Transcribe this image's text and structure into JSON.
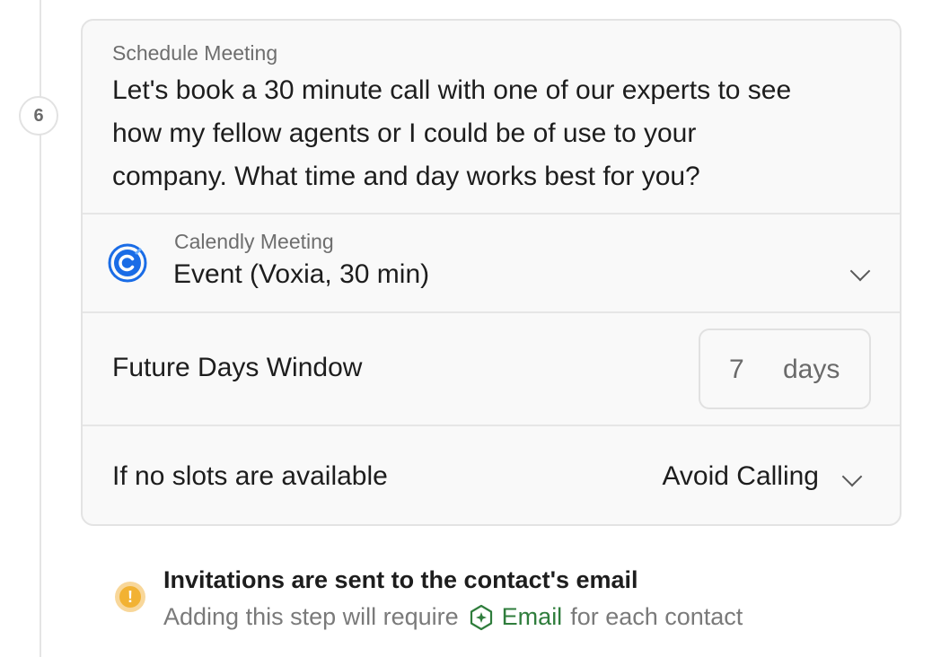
{
  "step": {
    "number": "6"
  },
  "message": {
    "label": "Schedule Meeting",
    "text_line1": "Let's book a 30 minute call with one of our experts to see",
    "text_line2": "how my fellow agents or I could be of use to your",
    "text_line3": "company. What time and day works best for you?"
  },
  "calendly": {
    "label": "Calendly Meeting",
    "event": "Event (Voxia, 30 min)",
    "brand_color": "#1a6ce6"
  },
  "future_window": {
    "label": "Future Days Window",
    "value": "7",
    "unit": "days"
  },
  "no_slots": {
    "label": "If no slots are available",
    "value": "Avoid Calling"
  },
  "notice": {
    "title": "Invitations are sent to the contact's email",
    "sub_prefix": "Adding this step will require",
    "sub_email": "Email",
    "sub_suffix": "for each contact",
    "warning_color": "#f2b233",
    "email_color": "#2f7d3c"
  }
}
